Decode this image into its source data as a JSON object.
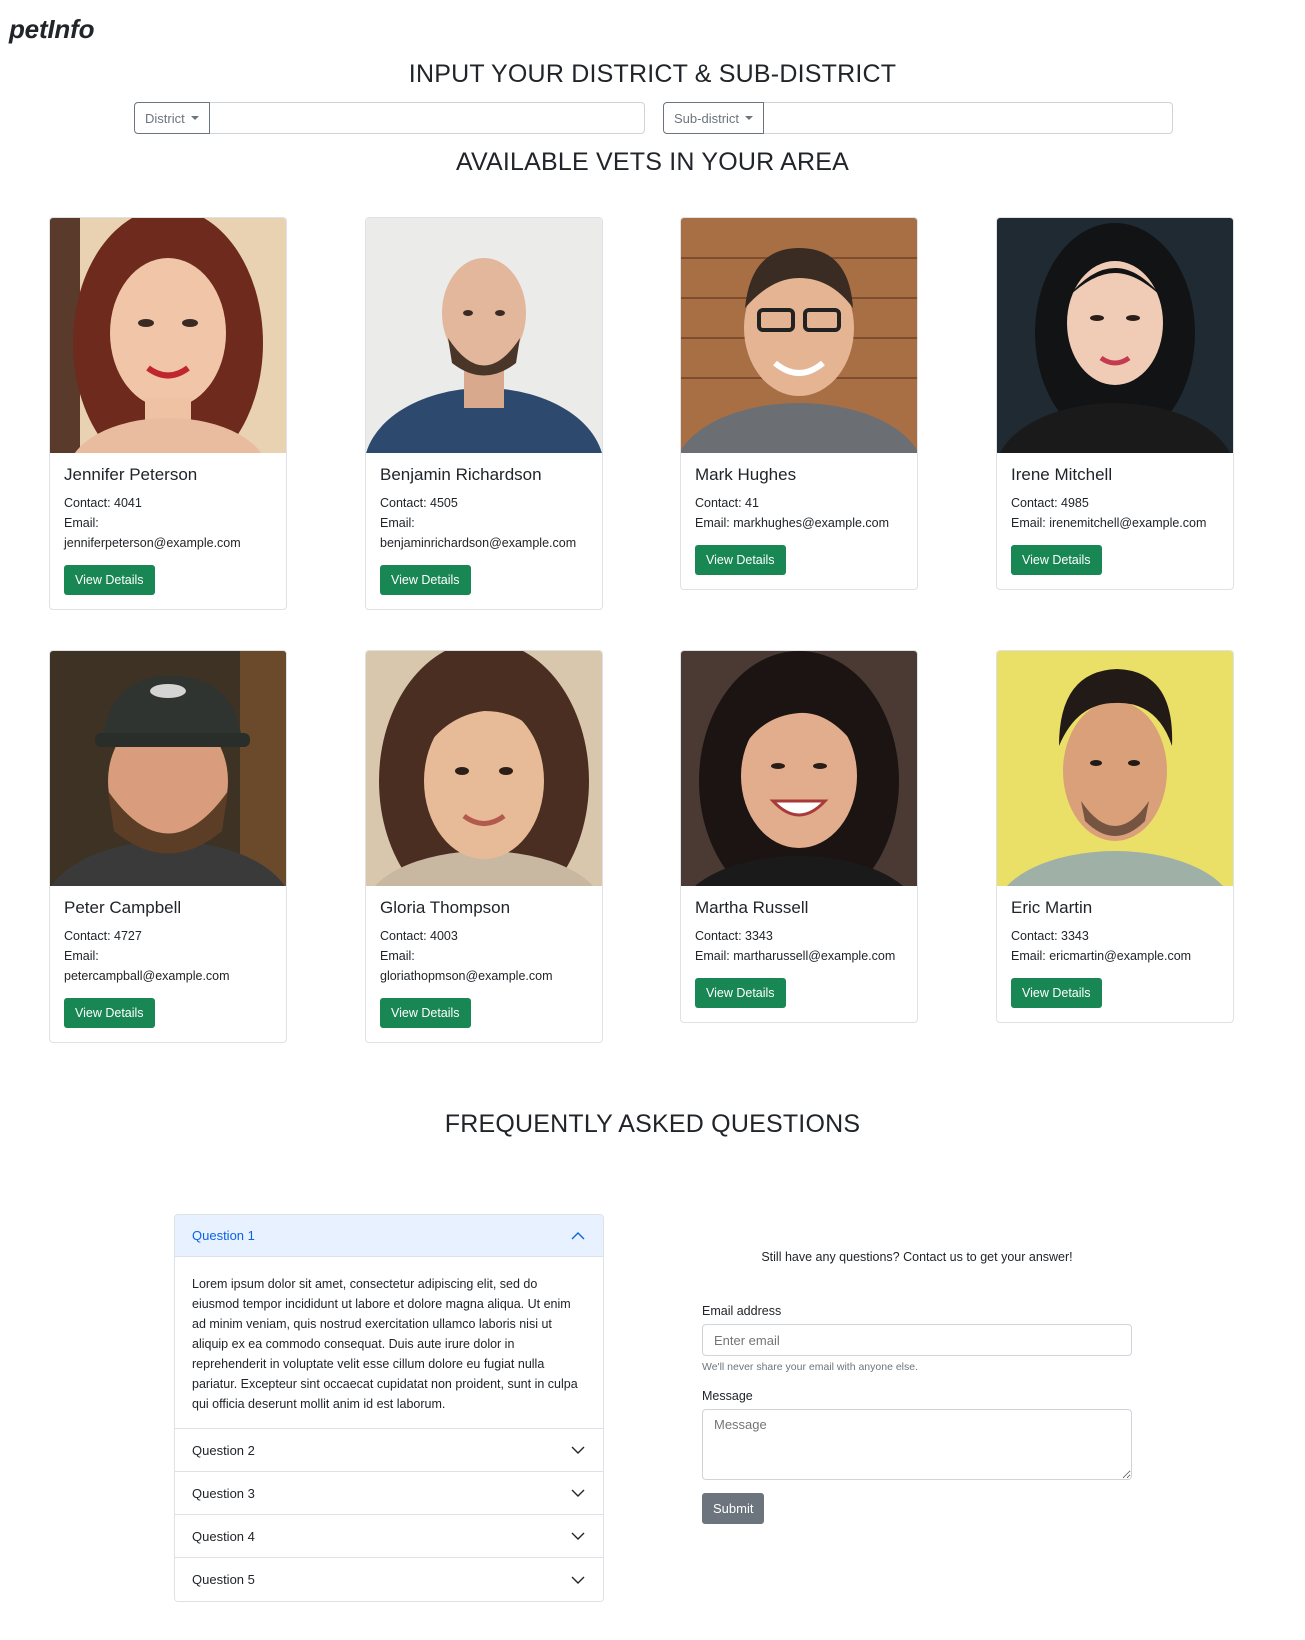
{
  "brand": "petInfo",
  "location": {
    "heading": "INPUT YOUR DISTRICT & SUB-DISTRICT",
    "district_label": "District",
    "subdistrict_label": "Sub-district"
  },
  "vets": {
    "heading": "AVAILABLE VETS IN YOUR AREA",
    "contact_prefix": "Contact:",
    "email_prefix": "Email:",
    "button_label": "View Details",
    "items": [
      {
        "name": "Jennifer Peterson",
        "contact": "Contact: 4041",
        "email_label": "Email:",
        "email": "jenniferpeterson@example.com",
        "button": "View Details"
      },
      {
        "name": "Benjamin Richardson",
        "contact": "Contact: 4505",
        "email_label": "Email:",
        "email": "benjaminrichardson@example.com",
        "button": "View Details"
      },
      {
        "name": "Mark Hughes",
        "contact": "Contact: 41",
        "email_line": "Email: markhughes@example.com",
        "button": "View Details"
      },
      {
        "name": "Irene Mitchell",
        "contact": "Contact: 4985",
        "email_line": "Email: irenemitchell@example.com",
        "button": "View Details"
      },
      {
        "name": "Peter Campbell",
        "contact": "Contact: 4727",
        "email_label": "Email:",
        "email": "petercampball@example.com",
        "button": "View Details"
      },
      {
        "name": "Gloria Thompson",
        "contact": "Contact: 4003",
        "email_label": "Email:",
        "email": "gloriathopmson@example.com",
        "button": "View Details"
      },
      {
        "name": "Martha Russell",
        "contact": "Contact: 3343",
        "email_line": "Email: martharussell@example.com",
        "button": "View Details"
      },
      {
        "name": "Eric Martin",
        "contact": "Contact: 3343",
        "email_line": "Email: ericmartin@example.com",
        "button": "View Details"
      }
    ]
  },
  "faq": {
    "heading": "FREQUENTLY ASKED QUESTIONS",
    "questions": [
      "Question 1",
      "Question 2",
      "Question 3",
      "Question 4",
      "Question 5"
    ],
    "answer": "Lorem ipsum dolor sit amet, consectetur adipiscing elit, sed do eiusmod tempor incididunt ut labore et dolore magna aliqua. Ut enim ad minim veniam, quis nostrud exercitation ullamco laboris nisi ut aliquip ex ea commodo consequat. Duis aute irure dolor in reprehenderit in voluptate velit esse cillum dolore eu fugiat nulla pariatur. Excepteur sint occaecat cupidatat non proident, sunt in culpa qui officia deserunt mollit anim id est laborum."
  },
  "contact": {
    "intro": "Still have any questions? Contact us to get your answer!",
    "email_label": "Email address",
    "email_placeholder": "Enter email",
    "email_help": "We'll never share your email with anyone else.",
    "message_label": "Message",
    "message_placeholder": "Message",
    "submit": "Submit"
  },
  "colors": {
    "success": "#198754",
    "secondary": "#6c757d",
    "accordion_active": "#e7f1ff",
    "link": "#0c63e4"
  }
}
